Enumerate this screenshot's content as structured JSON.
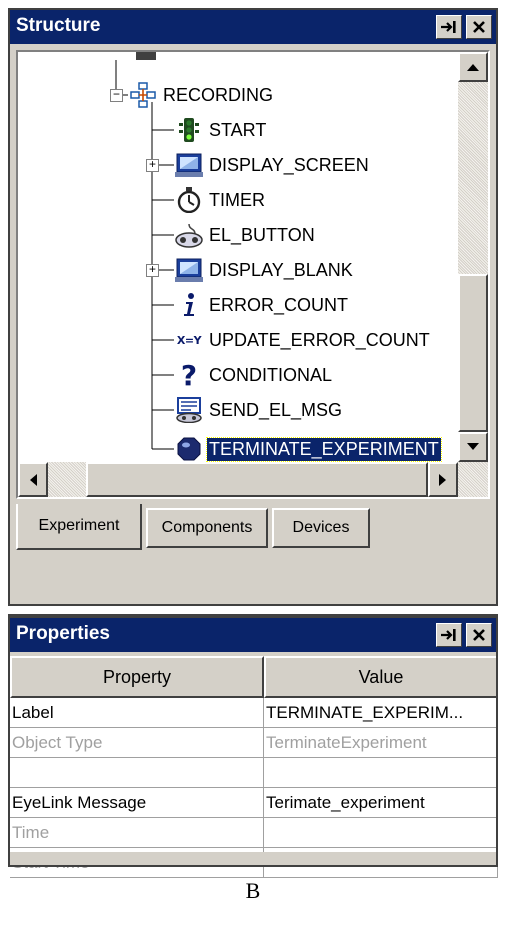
{
  "structure": {
    "title": "Structure",
    "pin_glyph": "→|",
    "close_glyph": "✕",
    "tree": [
      {
        "label": "RECORDING",
        "icon": "sequence-icon",
        "expander": "−"
      },
      {
        "label": "START",
        "icon": "traffic-light-icon"
      },
      {
        "label": "DISPLAY_SCREEN",
        "icon": "monitor-icon",
        "expander": "+"
      },
      {
        "label": "TIMER",
        "icon": "stopwatch-icon"
      },
      {
        "label": "EL_BUTTON",
        "icon": "gamepad-icon"
      },
      {
        "label": "DISPLAY_BLANK",
        "icon": "monitor-icon",
        "expander": "+"
      },
      {
        "label": "ERROR_COUNT",
        "icon": "info-icon"
      },
      {
        "label": "UPDATE_ERROR_COUNT",
        "icon": "update-variable-icon",
        "icon_text": "X=Y"
      },
      {
        "label": "CONDITIONAL",
        "icon": "question-icon",
        "icon_text": "?"
      },
      {
        "label": "SEND_EL_MSG",
        "icon": "send-message-icon"
      },
      {
        "label": "TERMINATE_EXPERIMENT",
        "icon": "terminate-icon",
        "selected": true
      }
    ],
    "tabs": [
      "Experiment",
      "Components",
      "Devices"
    ]
  },
  "properties": {
    "title": "Properties",
    "pin_glyph": "→|",
    "close_glyph": "✕",
    "columns": [
      "Property",
      "Value"
    ],
    "rows": [
      {
        "property": "Label",
        "value": "TERMINATE_EXPERIM...",
        "muted": false
      },
      {
        "property": "Object Type",
        "value": "TerminateExperiment",
        "muted": true
      },
      {
        "property": "",
        "value": "",
        "muted": false
      },
      {
        "property": "EyeLink Message",
        "value": "Terimate_experiment",
        "muted": false
      },
      {
        "property": "Time",
        "value": "",
        "muted": true
      },
      {
        "property": "Start Time",
        "value": "",
        "muted": true
      }
    ]
  },
  "caption": "B",
  "colors": {
    "titlebar": "#0a246a",
    "face": "#d4d0c8",
    "selection": "#0a246a"
  }
}
